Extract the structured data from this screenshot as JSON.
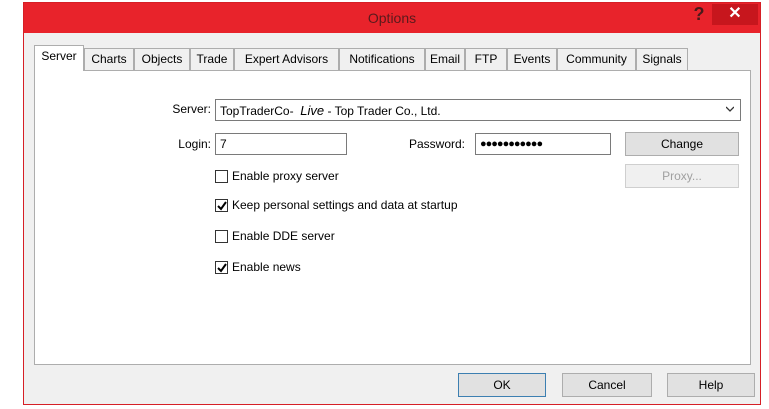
{
  "window": {
    "title": "Options",
    "help_glyph": "?",
    "close_glyph": "✕"
  },
  "tabs": [
    {
      "label": "Server",
      "active": true
    },
    {
      "label": "Charts"
    },
    {
      "label": "Objects"
    },
    {
      "label": "Trade"
    },
    {
      "label": "Expert Advisors"
    },
    {
      "label": "Notifications"
    },
    {
      "label": "Email"
    },
    {
      "label": "FTP"
    },
    {
      "label": "Events"
    },
    {
      "label": "Community"
    },
    {
      "label": "Signals"
    }
  ],
  "server": {
    "label": "Server:",
    "value_prefix": "TopTraderCo-",
    "value_italic": "Live",
    "value_suffix": " - Top Trader Co., Ltd."
  },
  "login": {
    "label": "Login:",
    "value": "7"
  },
  "password": {
    "label": "Password:",
    "masked_value": "●●●●●●●●●●●"
  },
  "buttons": {
    "change": "Change",
    "proxy": "Proxy...",
    "ok": "OK",
    "cancel": "Cancel",
    "help": "Help"
  },
  "options": [
    {
      "label": "Enable proxy server",
      "checked": false
    },
    {
      "label": "Keep personal settings and data at startup",
      "checked": true
    },
    {
      "label": "Enable DDE server",
      "checked": false
    },
    {
      "label": "Enable news",
      "checked": true
    }
  ],
  "colors": {
    "titlebar": "#e8232b",
    "close": "#c7161d",
    "dialog_bg": "#f0f0f0"
  }
}
